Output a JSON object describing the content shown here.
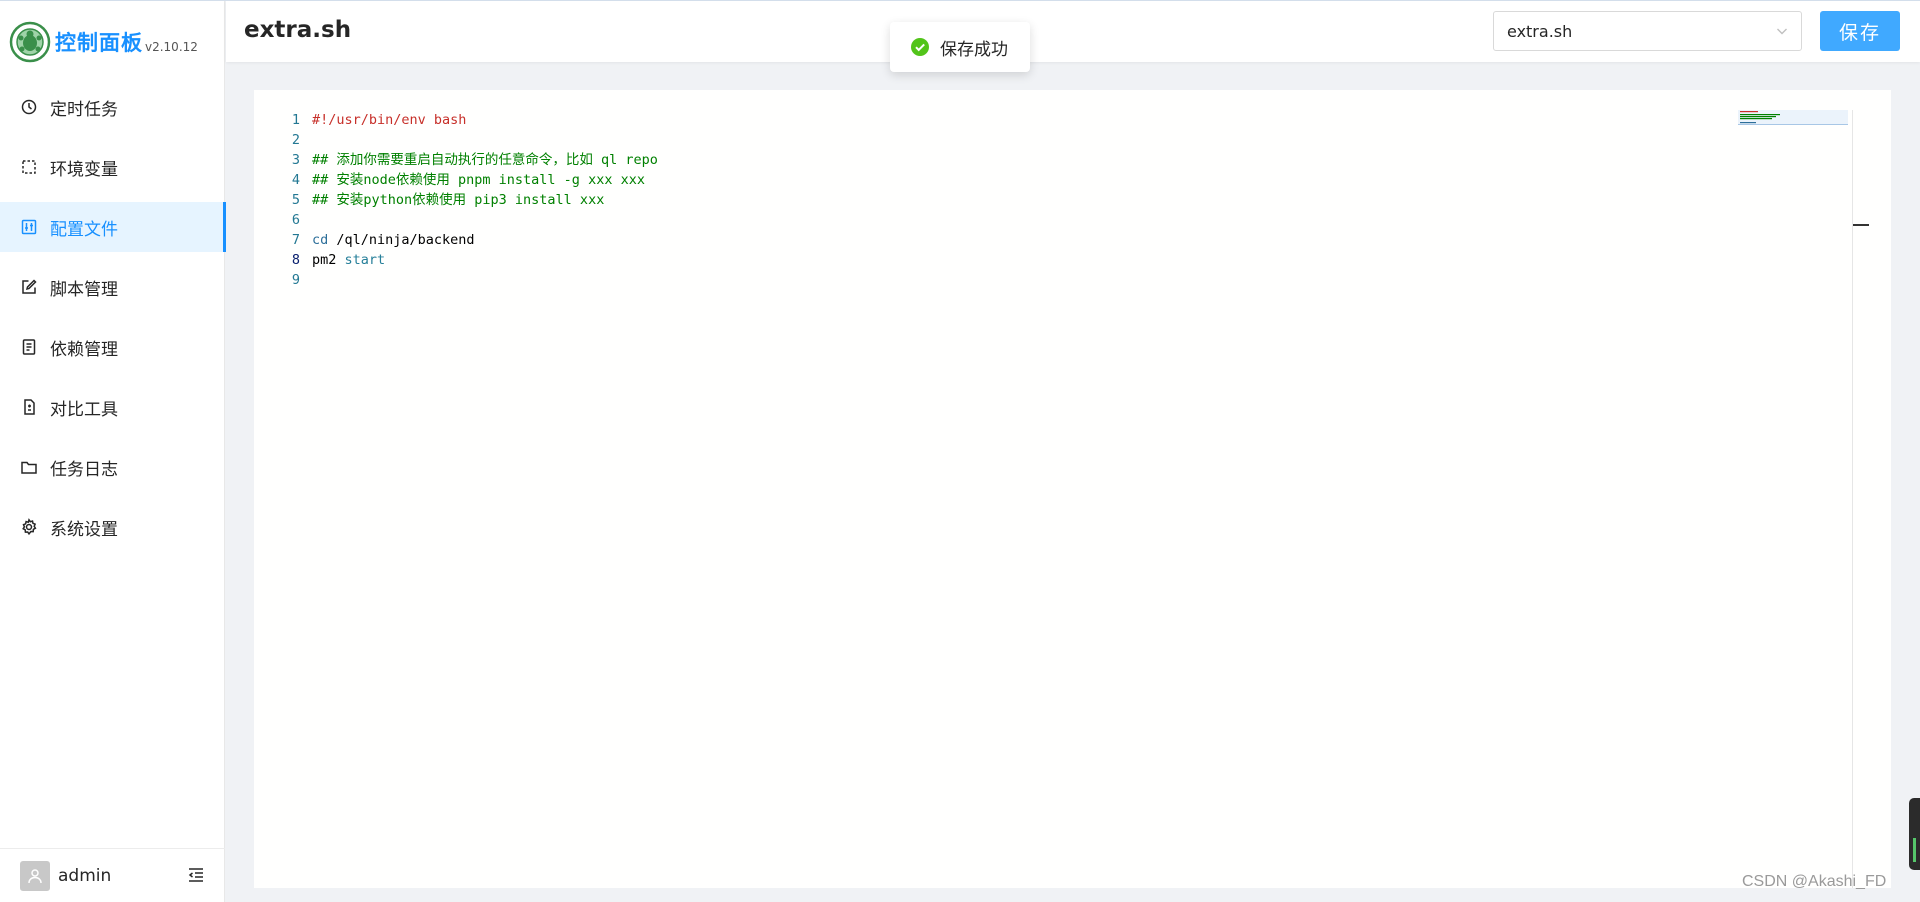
{
  "brand": {
    "title": "控制面板",
    "version": "v2.10.12"
  },
  "sidebar": {
    "items": [
      {
        "label": "定时任务",
        "icon": "clock-icon"
      },
      {
        "label": "环境变量",
        "icon": "dashed-frame-icon"
      },
      {
        "label": "配置文件",
        "icon": "sliders-icon",
        "active": true
      },
      {
        "label": "脚本管理",
        "icon": "edit-icon"
      },
      {
        "label": "依赖管理",
        "icon": "file-list-icon"
      },
      {
        "label": "对比工具",
        "icon": "diff-icon"
      },
      {
        "label": "任务日志",
        "icon": "folder-icon"
      },
      {
        "label": "系统设置",
        "icon": "gear-icon"
      }
    ],
    "user": {
      "name": "admin"
    }
  },
  "header": {
    "title": "extra.sh",
    "file_select_value": "extra.sh",
    "save_label": "保存"
  },
  "toast": {
    "message": "保存成功",
    "status_color": "#52c41a"
  },
  "editor": {
    "lines": [
      {
        "no": "1",
        "text": "#!/usr/bin/env bash"
      },
      {
        "no": "2",
        "text": ""
      },
      {
        "no": "3",
        "text": "## 添加你需要重启自动执行的任意命令，比如 ql repo"
      },
      {
        "no": "4",
        "text": "## 安装node依赖使用 pnpm install -g xxx xxx"
      },
      {
        "no": "5",
        "text": "## 安装python依赖使用 pip3 install xxx"
      },
      {
        "no": "6",
        "text": ""
      },
      {
        "no": "7",
        "cmd": "cd",
        "arg": " /ql/ninja/backend"
      },
      {
        "no": "8",
        "cmd": "pm2",
        "arg": " start"
      },
      {
        "no": "9",
        "text": ""
      }
    ]
  },
  "watermark": "CSDN @Akashi_FD",
  "colors": {
    "accent": "#1890ff",
    "save_button": "#40a9ff",
    "active_bg": "#e6f4ff"
  }
}
